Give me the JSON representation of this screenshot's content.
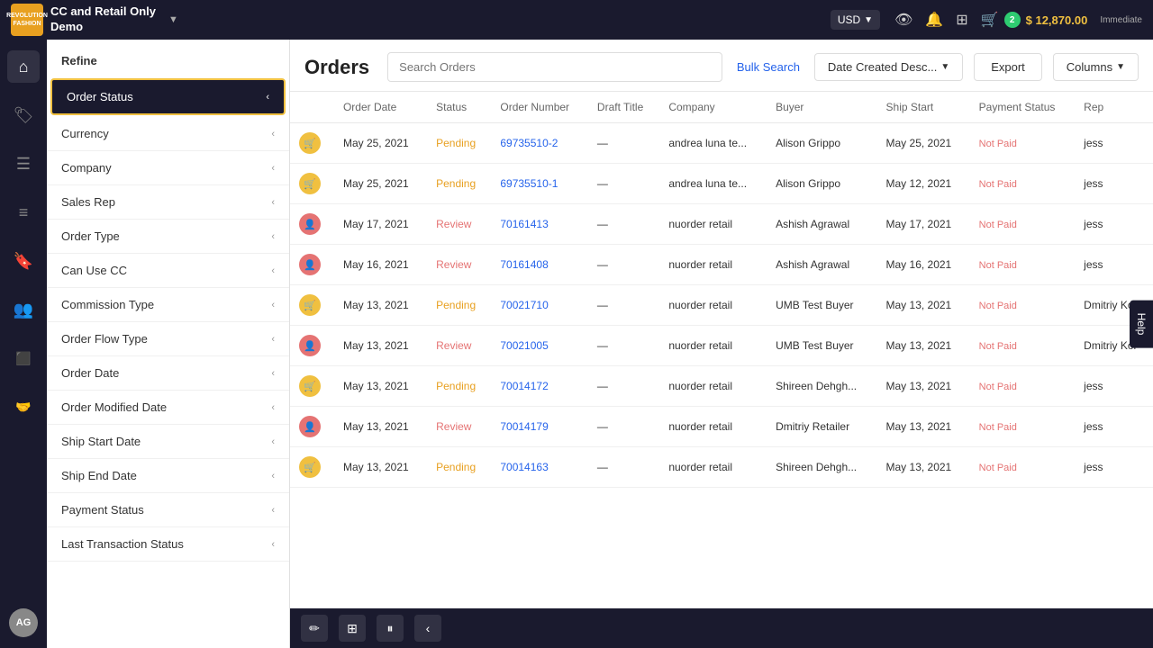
{
  "topNav": {
    "logoText": "REVOLUTION\nFASHION",
    "brandName": "CC and Retail Only\nDemo",
    "dropdownArrow": "▼",
    "currency": "USD",
    "currencyArrow": "▼",
    "cartCount": "2",
    "amount": "$ 12,870.00",
    "immediateLabel": "Immediate"
  },
  "sidebar": {
    "icons": [
      {
        "name": "home-icon",
        "glyph": "⌂"
      },
      {
        "name": "tag-icon",
        "glyph": "🏷"
      },
      {
        "name": "list-icon",
        "glyph": "☰"
      },
      {
        "name": "orders-icon",
        "glyph": "≡"
      },
      {
        "name": "bookmark-icon",
        "glyph": "🔖"
      },
      {
        "name": "users-icon",
        "glyph": "👥"
      },
      {
        "name": "box-icon",
        "glyph": "⬛"
      },
      {
        "name": "handshake-icon",
        "glyph": "🤝"
      }
    ],
    "avatarInitials": "AG"
  },
  "refine": {
    "header": "Refine",
    "items": [
      {
        "label": "Order Status",
        "highlighted": true
      },
      {
        "label": "Currency",
        "highlighted": false
      },
      {
        "label": "Company",
        "highlighted": false
      },
      {
        "label": "Sales Rep",
        "highlighted": false
      },
      {
        "label": "Order Type",
        "highlighted": false
      },
      {
        "label": "Can Use CC",
        "highlighted": false
      },
      {
        "label": "Commission Type",
        "highlighted": false
      },
      {
        "label": "Order Flow Type",
        "highlighted": false
      },
      {
        "label": "Order Date",
        "highlighted": false
      },
      {
        "label": "Order Modified Date",
        "highlighted": false
      },
      {
        "label": "Ship Start Date",
        "highlighted": false
      },
      {
        "label": "Ship End Date",
        "highlighted": false
      },
      {
        "label": "Payment Status",
        "highlighted": false
      },
      {
        "label": "Last Transaction Status",
        "highlighted": false
      }
    ]
  },
  "orders": {
    "title": "Orders",
    "searchPlaceholder": "Search Orders",
    "bulkSearchLabel": "Bulk Search",
    "dateSortLabel": "Date Created Desc...",
    "exportLabel": "Export",
    "columnsLabel": "Columns"
  },
  "tableHeaders": [
    "",
    "Order Date",
    "Status",
    "Order Number",
    "Draft Title",
    "Company",
    "Buyer",
    "Ship Start",
    "Payment Status",
    "Rep"
  ],
  "tableRows": [
    {
      "iconType": "pending",
      "orderDate": "May 25, 2021",
      "status": "Pending",
      "orderNumber": "69735510-2",
      "draftTitle": "—",
      "company": "andrea luna te...",
      "buyer": "Alison Grippo",
      "shipStart": "May 25, 2021",
      "paymentStatus": "Not Paid",
      "rep": "jess"
    },
    {
      "iconType": "pending",
      "orderDate": "May 25, 2021",
      "status": "Pending",
      "orderNumber": "69735510-1",
      "draftTitle": "—",
      "company": "andrea luna te...",
      "buyer": "Alison Grippo",
      "shipStart": "May 12, 2021",
      "paymentStatus": "Not Paid",
      "rep": "jess"
    },
    {
      "iconType": "review",
      "orderDate": "May 17, 2021",
      "status": "Review",
      "orderNumber": "70161413",
      "draftTitle": "—",
      "company": "nuorder retail",
      "buyer": "Ashish Agrawal",
      "shipStart": "May 17, 2021",
      "paymentStatus": "Not Paid",
      "rep": "jess"
    },
    {
      "iconType": "review",
      "orderDate": "May 16, 2021",
      "status": "Review",
      "orderNumber": "70161408",
      "draftTitle": "—",
      "company": "nuorder retail",
      "buyer": "Ashish Agrawal",
      "shipStart": "May 16, 2021",
      "paymentStatus": "Not Paid",
      "rep": "jess"
    },
    {
      "iconType": "pending",
      "orderDate": "May 13, 2021",
      "status": "Pending",
      "orderNumber": "70021710",
      "draftTitle": "—",
      "company": "nuorder retail",
      "buyer": "UMB Test Buyer",
      "shipStart": "May 13, 2021",
      "paymentStatus": "Not Paid",
      "rep": "Dmitriy Kol"
    },
    {
      "iconType": "review",
      "orderDate": "May 13, 2021",
      "status": "Review",
      "orderNumber": "70021005",
      "draftTitle": "—",
      "company": "nuorder retail",
      "buyer": "UMB Test Buyer",
      "shipStart": "May 13, 2021",
      "paymentStatus": "Not Paid",
      "rep": "Dmitriy Kol"
    },
    {
      "iconType": "pending",
      "orderDate": "May 13, 2021",
      "status": "Pending",
      "orderNumber": "70014172",
      "draftTitle": "—",
      "company": "nuorder retail",
      "buyer": "Shireen Dehgh...",
      "shipStart": "May 13, 2021",
      "paymentStatus": "Not Paid",
      "rep": "jess"
    },
    {
      "iconType": "review",
      "orderDate": "May 13, 2021",
      "status": "Review",
      "orderNumber": "70014179",
      "draftTitle": "—",
      "company": "nuorder retail",
      "buyer": "Dmitriy Retailer",
      "shipStart": "May 13, 2021",
      "paymentStatus": "Not Paid",
      "rep": "jess"
    },
    {
      "iconType": "pending",
      "orderDate": "May 13, 2021",
      "status": "Pending",
      "orderNumber": "70014163",
      "draftTitle": "—",
      "company": "nuorder retail",
      "buyer": "Shireen Dehgh...",
      "shipStart": "May 13, 2021",
      "paymentStatus": "Not Paid",
      "rep": "jess"
    }
  ],
  "bottomToolbar": {
    "editIcon": "✏",
    "groupIcon": "⊞",
    "pauseIcon": "⏸",
    "collapseIcon": "‹"
  },
  "helpButton": "Help"
}
